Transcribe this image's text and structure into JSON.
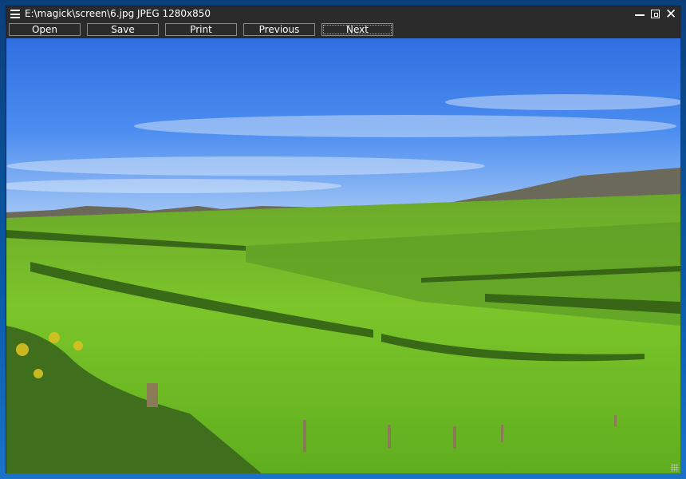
{
  "window": {
    "title": "E:\\magick\\screen\\6.jpg JPEG 1280x850",
    "menu_icon": "hamburger-icon",
    "controls": {
      "minimize": "minimize-icon",
      "maximize": "maximize-icon",
      "close": "✕"
    }
  },
  "toolbar": {
    "open": "Open",
    "save": "Save",
    "print": "Print",
    "previous": "Previous",
    "next": "Next"
  },
  "image": {
    "description_icon": "landscape-photo"
  }
}
